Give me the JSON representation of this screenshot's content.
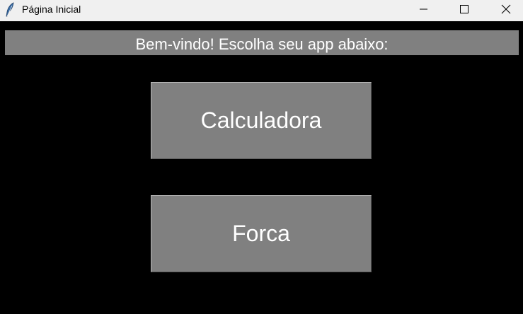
{
  "window": {
    "title": "Página Inicial",
    "app_icon": "feather-icon",
    "controls": {
      "minimize_icon": "minimize-icon",
      "maximize_icon": "maximize-icon",
      "close_icon": "close-icon"
    }
  },
  "main": {
    "welcome": "Bem-vindo! Escolha seu app abaixo:",
    "buttons": [
      {
        "label": "Calculadora"
      },
      {
        "label": "Forca"
      }
    ]
  },
  "colors": {
    "background": "#000000",
    "panel": "#808080",
    "text": "#ffffff",
    "titlebar": "#f0f0f0"
  }
}
